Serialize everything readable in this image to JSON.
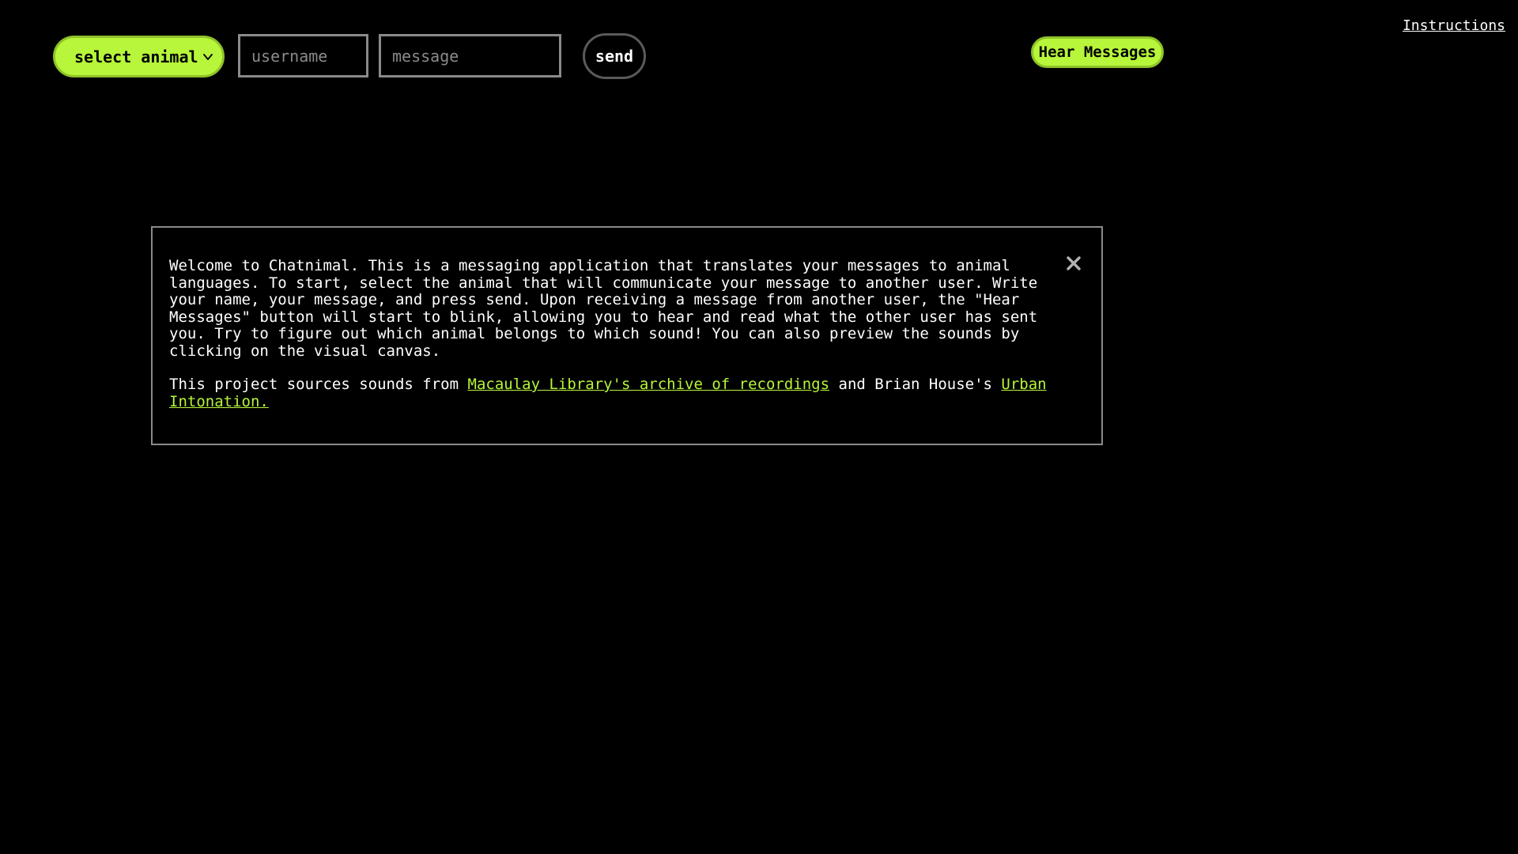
{
  "toolbar": {
    "animal_select_label": "select animal",
    "username_placeholder": "username",
    "message_placeholder": "message",
    "send_label": "send",
    "hear_messages_label": "Hear Messages",
    "instructions_label": "Instructions"
  },
  "modal": {
    "intro_text": "Welcome to Chatnimal. This is a messaging application that translates your messages to animal languages. To start, select the animal that will communicate your message to another user. Write your name, your message, and press send. Upon receiving a message from another user, the \"Hear Messages\" button will start to blink, allowing you to hear and read what the other user has sent you. Try to figure out which animal belongs to which sound! You can also preview the sounds by clicking on the visual canvas.",
    "sources_prefix": "This project sources sounds from ",
    "macaulay_link": "Macaulay Library's archive of recordings",
    "sources_middle": " and Brian House's ",
    "urban_link": "Urban Intonation."
  },
  "colors": {
    "accent": "#b7f63a",
    "background": "#000000",
    "border": "#8a8a8a"
  },
  "icons": {
    "dropdown": "chevron-down-icon",
    "close": "close-icon"
  }
}
